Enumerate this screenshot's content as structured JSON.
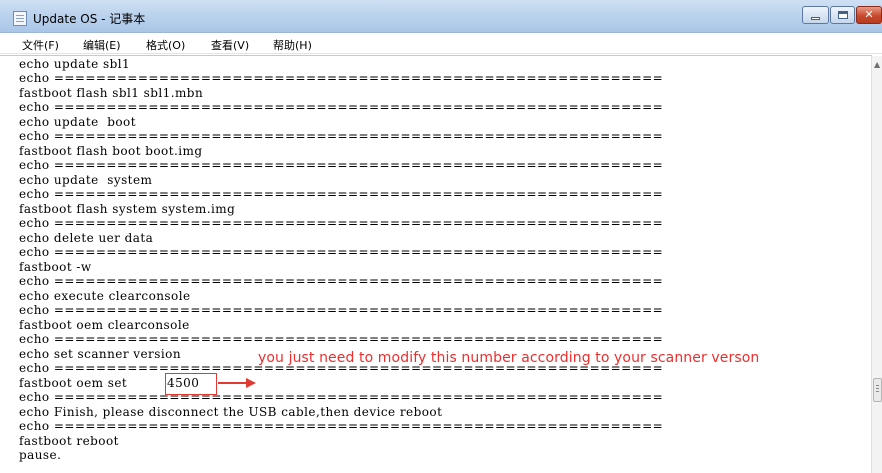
{
  "window": {
    "title": "Update OS - 记事本",
    "buttons": {
      "minimize": "minimize-icon",
      "maximize": "maximize-icon",
      "close": "close-icon"
    }
  },
  "menu": [
    {
      "label": "文件(F)"
    },
    {
      "label": "编辑(E)"
    },
    {
      "label": "格式(O)"
    },
    {
      "label": "查看(V)"
    },
    {
      "label": "帮助(H)"
    }
  ],
  "editor": {
    "lines": [
      "echo update sbl1",
      "echo ==========================================================",
      "fastboot flash sbl1 sbl1.mbn",
      "echo ==========================================================",
      "echo update  boot",
      "echo ==========================================================",
      "fastboot flash boot boot.img",
      "echo ==========================================================",
      "echo update  system",
      "echo ==========================================================",
      "fastboot flash system system.img",
      "echo ==========================================================",
      "echo delete uer data",
      "echo ==========================================================",
      "fastboot -w",
      "echo ==========================================================",
      "echo execute clearconsole",
      "echo ==========================================================",
      "fastboot oem clearconsole",
      "echo ==========================================================",
      "echo set scanner version",
      "echo ==========================================================",
      "fastboot oem set",
      "echo ==========================================================",
      "echo Finish, please disconnect the USB cable,then device reboot",
      "echo ==========================================================",
      "fastboot reboot",
      "pause."
    ],
    "highlighted_value": "4500"
  },
  "annotation": {
    "text": "you just need to modify this number according to your  scanner verson",
    "color": "#ee2d2d"
  },
  "colors": {
    "titlebar": "#bcd3ee",
    "close_button": "#c84a2e"
  }
}
